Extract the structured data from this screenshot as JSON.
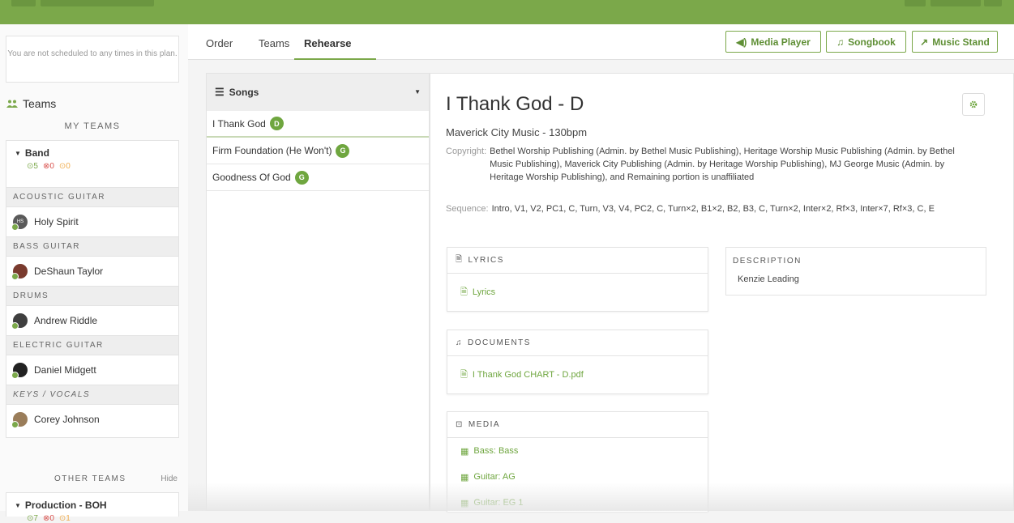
{
  "sidebar": {
    "notice": "You are not scheduled to any times in this plan.",
    "teams_title": "Teams",
    "my_teams_label": "MY TEAMS",
    "band": {
      "name": "Band",
      "confirmed": "5",
      "declined": "0",
      "pending": "0",
      "positions": [
        {
          "title": "ACOUSTIC GUITAR",
          "member": "Holy Spirit",
          "initials": "HS"
        },
        {
          "title": "BASS GUITAR",
          "member": "DeShaun Taylor",
          "initials": ""
        },
        {
          "title": "DRUMS",
          "member": "Andrew Riddle",
          "initials": ""
        },
        {
          "title": "ELECTRIC GUITAR",
          "member": "Daniel Midgett",
          "initials": ""
        },
        {
          "title": "KEYS / VOCALS",
          "member": "Corey Johnson",
          "initials": ""
        }
      ]
    },
    "other_teams_label": "OTHER TEAMS",
    "hide_label": "Hide",
    "production": {
      "name": "Production - BOH",
      "confirmed": "7",
      "declined": "0",
      "pending": "1"
    }
  },
  "tabs": [
    "Order",
    "Teams",
    "Rehearse"
  ],
  "toolbar": {
    "media_player": "Media Player",
    "songbook": "Songbook",
    "music_stand": "Music Stand"
  },
  "songs": {
    "header": "Songs",
    "items": [
      {
        "title": "I Thank God",
        "key": "D"
      },
      {
        "title": "Firm Foundation (He Won't)",
        "key": "G"
      },
      {
        "title": "Goodness Of God",
        "key": "G"
      }
    ]
  },
  "detail": {
    "title": "I Thank God - D",
    "artist": "Maverick City Music - 130bpm",
    "copyright_label": "Copyright:",
    "copyright": "Bethel Worship Publishing (Admin. by Bethel Music Publishing), Heritage Worship Music Publishing (Admin. by Bethel Music Publishing), Maverick City Publishing (Admin. by Heritage Worship Publishing), MJ George Music (Admin. by Heritage Worship Publishing), and Remaining portion is unaffiliated",
    "sequence_label": "Sequence:",
    "sequence": "Intro, V1, V2, PC1, C, Turn, V3, V4, PC2, C, Turn×2, B1×2, B2, B3, C, Turn×2, Inter×2, Rf×3, Inter×7, Rf×3, C, E",
    "lyrics": {
      "header": "LYRICS",
      "item": "Lyrics"
    },
    "documents": {
      "header": "DOCUMENTS",
      "item": "I Thank God CHART - D.pdf"
    },
    "media": {
      "header": "MEDIA",
      "items": [
        "Bass: Bass",
        "Guitar: AG",
        "Guitar: EG 1"
      ]
    },
    "description": {
      "header": "DESCRIPTION",
      "text": "Kenzie Leading"
    }
  }
}
